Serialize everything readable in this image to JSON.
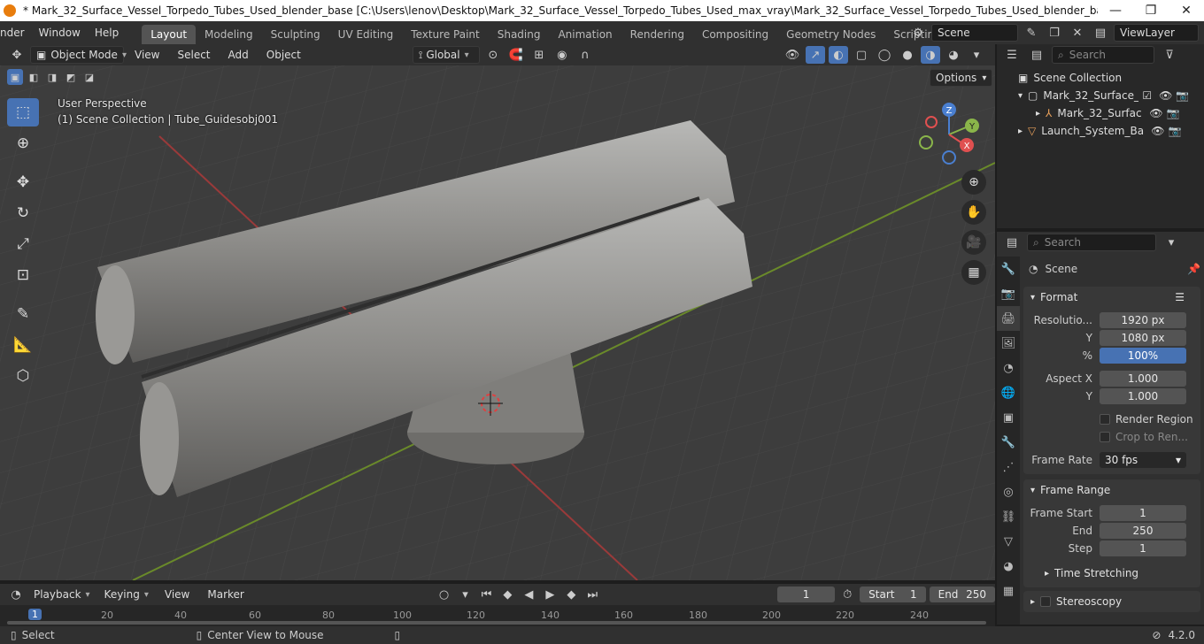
{
  "window": {
    "title": "* Mark_32_Surface_Vessel_Torpedo_Tubes_Used_blender_base [C:\\Users\\lenov\\Desktop\\Mark_32_Surface_Vessel_Torpedo_Tubes_Used_max_vray\\Mark_32_Surface_Vessel_Torpedo_Tubes_Used_blender_base.blend] - Blender 4.2",
    "minimize": "—",
    "maximize": "❐",
    "close": "✕"
  },
  "menus": [
    "nder",
    "Window",
    "Help"
  ],
  "workspaces": [
    {
      "label": "Layout",
      "active": true
    },
    {
      "label": "Modeling"
    },
    {
      "label": "Sculpting"
    },
    {
      "label": "UV Editing"
    },
    {
      "label": "Texture Paint"
    },
    {
      "label": "Shading"
    },
    {
      "label": "Animation"
    },
    {
      "label": "Rendering"
    },
    {
      "label": "Compositing"
    },
    {
      "label": "Geometry Nodes"
    },
    {
      "label": "Scripting"
    }
  ],
  "add_workspace": "+",
  "scene_field": "Scene",
  "viewlayer_field": "ViewLayer",
  "header": {
    "mode": "Object Mode",
    "menu": [
      "View",
      "Select",
      "Add",
      "Object"
    ],
    "transform": "Global",
    "options": "Options"
  },
  "viewport": {
    "perspective": "User Perspective",
    "context": "(1) Scene Collection | Tube_Guidesobj001"
  },
  "gizmo": {
    "x": "X",
    "y": "Y",
    "z": "Z"
  },
  "outliner": {
    "search_placeholder": "Search",
    "root": "Scene Collection",
    "items": [
      "Mark_32_Surface_V",
      "Mark_32_Surfac",
      "Launch_System_Ba"
    ]
  },
  "properties": {
    "search_placeholder": "Search",
    "scene": "Scene",
    "format": {
      "title": "Format",
      "res_label": "Resolutio...",
      "res_x": "1920 px",
      "y_label": "Y",
      "res_y": "1080 px",
      "pct_label": "%",
      "pct": "100%",
      "aspect_label": "Aspect X",
      "aspect_x": "1.000",
      "aspect_y": "1.000",
      "render_region": "Render Region",
      "crop": "Crop to Ren...",
      "fps_label": "Frame Rate",
      "fps": "30 fps"
    },
    "frame_range": {
      "title": "Frame Range",
      "start_label": "Frame Start",
      "start": "1",
      "end_label": "End",
      "end": "250",
      "step_label": "Step",
      "step": "1"
    },
    "time_stretching": "Time Stretching",
    "stereoscopy": "Stereoscopy"
  },
  "timeline": {
    "playback": "Playback",
    "keying": "Keying",
    "view": "View",
    "marker": "Marker",
    "current": "1",
    "start_label": "Start",
    "start": "1",
    "end_label": "End",
    "end": "250",
    "ticks": [
      "1",
      "20",
      "40",
      "60",
      "80",
      "100",
      "120",
      "140",
      "160",
      "180",
      "200",
      "220",
      "240"
    ]
  },
  "status": {
    "select": "Select",
    "center": "Center View to Mouse",
    "version": "4.2.0"
  }
}
